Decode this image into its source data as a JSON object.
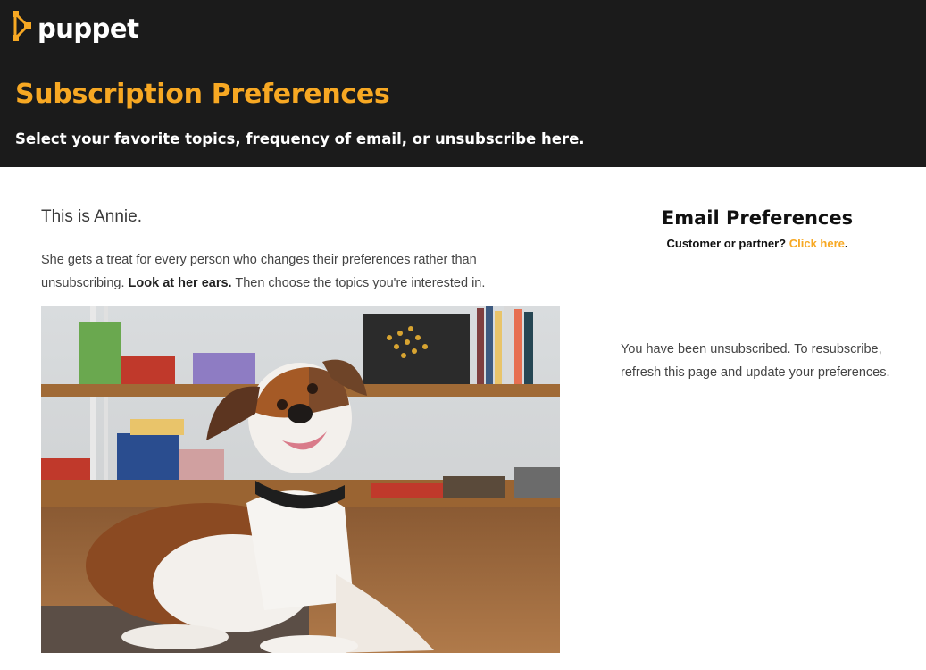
{
  "brand": {
    "logo_text": "puppet",
    "accent": "#f7a823",
    "header_bg": "#1b1b1b"
  },
  "header": {
    "title": "Subscription Preferences",
    "subtitle": "Select your favorite topics, frequency of email, or unsubscribe here."
  },
  "intro": {
    "heading": "This is Annie.",
    "text_before": "She gets a treat for every person who changes their preferences rather than unsubscribing. ",
    "text_bold": "Look at her ears.",
    "text_after": " Then choose the topics you're interested in."
  },
  "photo": {
    "subject": "dog-photo"
  },
  "sidebar": {
    "title": "Email Preferences",
    "sub_prefix": "Customer or partner? ",
    "link_label": "Click here",
    "sub_suffix": ".",
    "status_message": "You have been unsubscribed. To resubscribe, refresh this page and update your preferences."
  }
}
